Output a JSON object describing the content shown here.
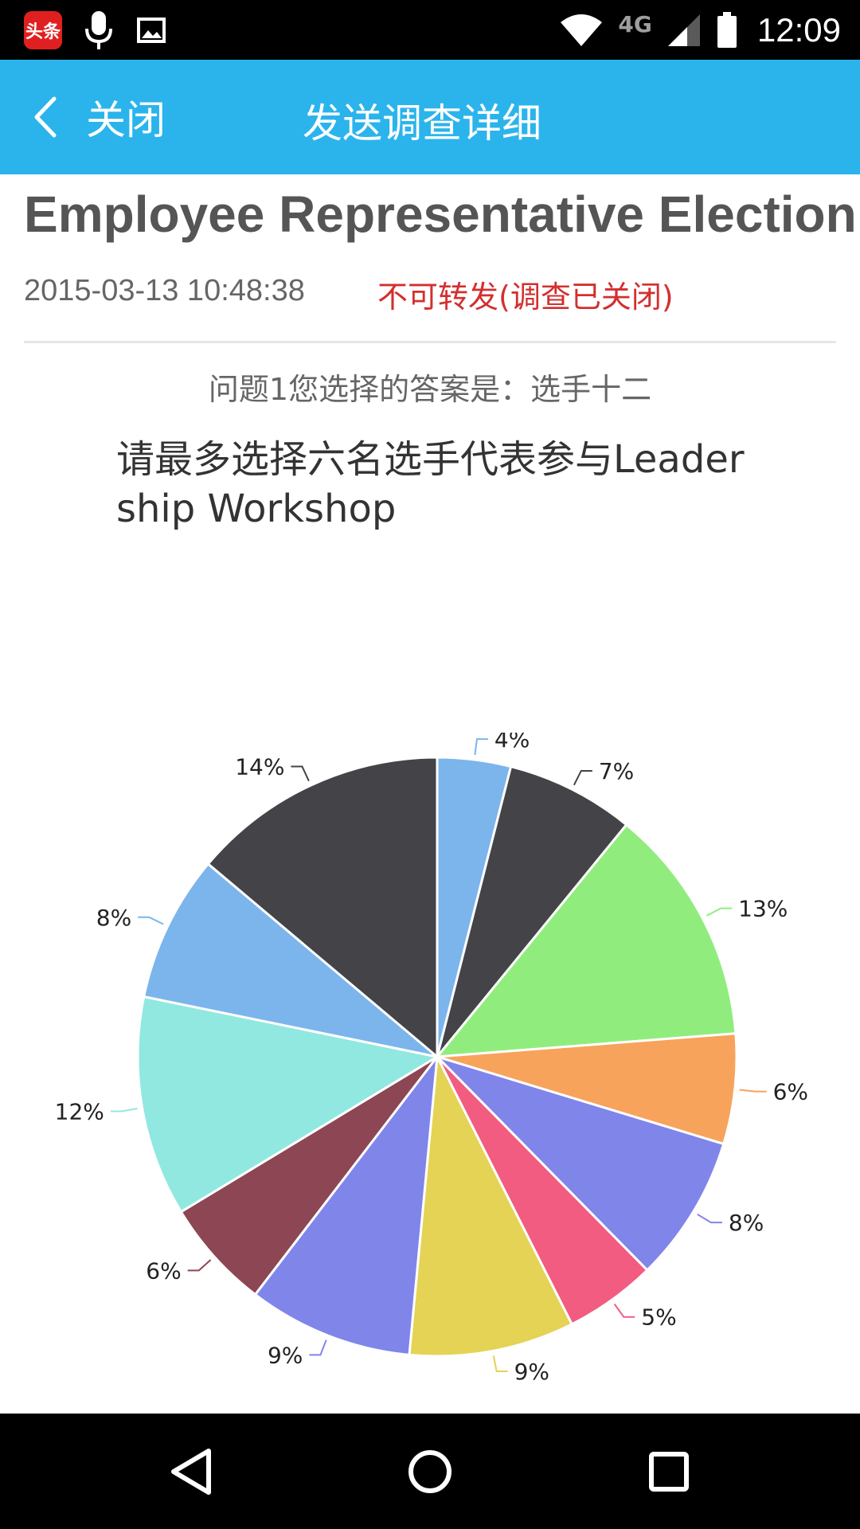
{
  "status_bar": {
    "app_badge_text": "头条",
    "network": "4G",
    "time": "12:09",
    "icons": [
      "toutiao-app-icon",
      "microphone-icon",
      "image-icon",
      "wifi-icon",
      "signal-icon",
      "battery-icon"
    ]
  },
  "app_bar": {
    "back_label": "关闭",
    "title": "发送调查详细",
    "background": "#2bb4ec"
  },
  "survey": {
    "title": "Employee Representative Election",
    "date": "2015-03-13 10:48:38",
    "status": "不可转发(调查已关闭)",
    "answer_line": "问题1您选择的答案是：选手十二",
    "question": "请最多选择六名选手代表参与Leadership Workshop"
  },
  "chart_data": {
    "type": "pie",
    "start_angle_deg": 0,
    "direction": "clockwise",
    "slices": [
      {
        "label": "4%",
        "value": 4,
        "color": "#7cb5ec"
      },
      {
        "label": "7%",
        "value": 7,
        "color": "#434348"
      },
      {
        "label": "13%",
        "value": 13,
        "color": "#90ed7d"
      },
      {
        "label": "6%",
        "value": 6,
        "color": "#f7a35c"
      },
      {
        "label": "8%",
        "value": 8,
        "color": "#8085e9"
      },
      {
        "label": "5%",
        "value": 5,
        "color": "#f15c80"
      },
      {
        "label": "9%",
        "value": 9,
        "color": "#e4d354"
      },
      {
        "label": "9%",
        "value": 9,
        "color": "#8085e9"
      },
      {
        "label": "6%",
        "value": 6,
        "color": "#8d4653"
      },
      {
        "label": "12%",
        "value": 12,
        "color": "#91e8e1"
      },
      {
        "label": "8%",
        "value": 8,
        "color": "#7cb5ec"
      },
      {
        "label": "14%",
        "value": 14,
        "color": "#434348"
      }
    ]
  },
  "nav_bar": {
    "icons": [
      "back-triangle-icon",
      "home-circle-icon",
      "recents-square-icon"
    ]
  }
}
